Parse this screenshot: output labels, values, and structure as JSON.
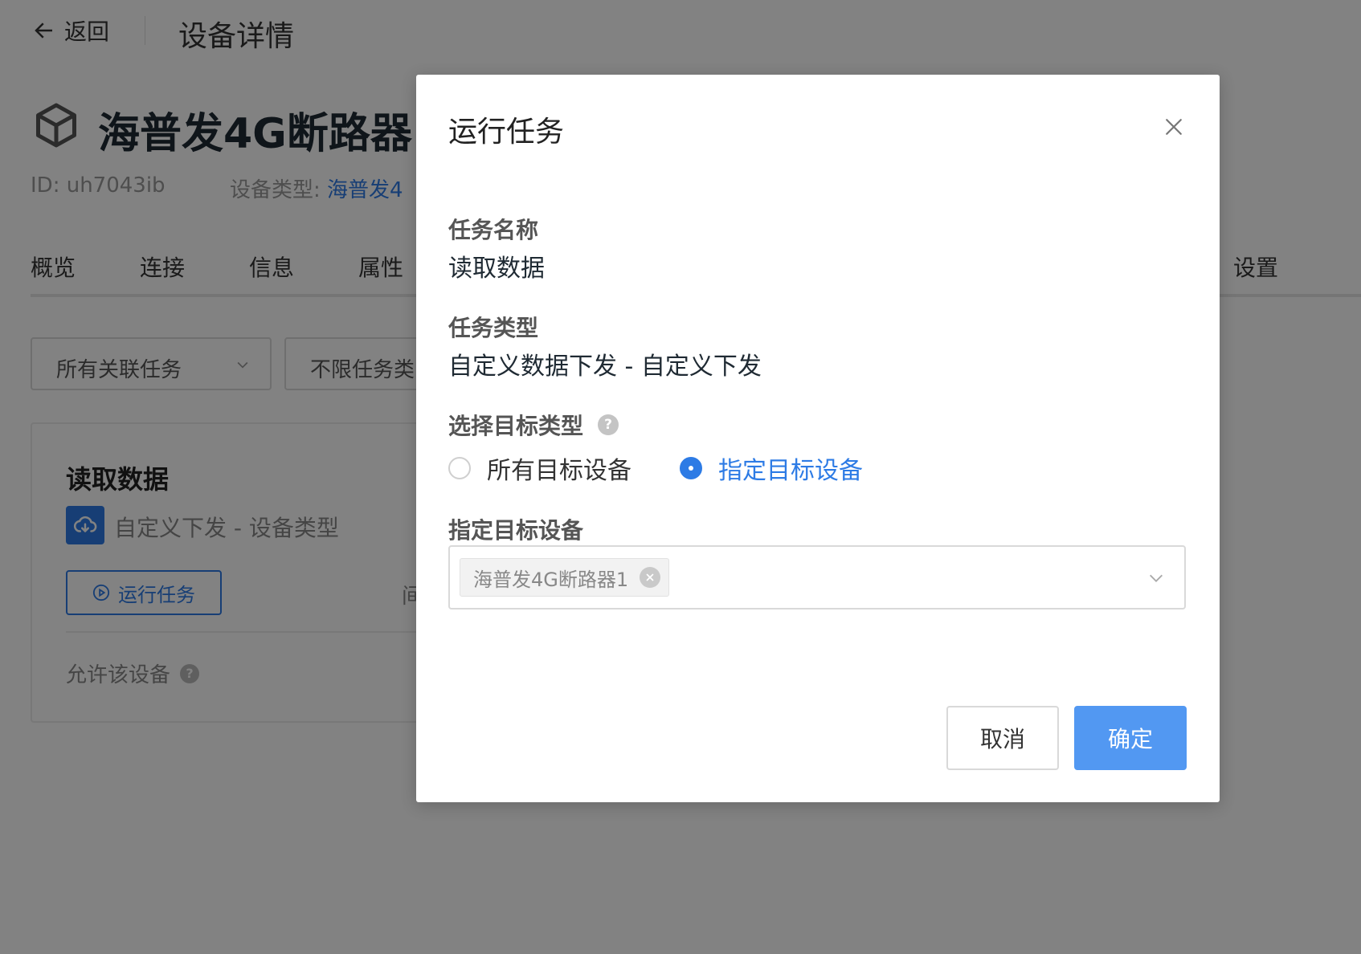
{
  "header": {
    "back_label": "返回",
    "page_title": "设备详情"
  },
  "device": {
    "name": "海普发4G断路器1",
    "id_text": "ID: uh7043ib",
    "type_label": "设备类型: ",
    "type_value": "海普发4"
  },
  "tabs": [
    {
      "label": "概览"
    },
    {
      "label": "连接"
    },
    {
      "label": "信息"
    },
    {
      "label": "属性"
    },
    {
      "label": "设置"
    }
  ],
  "filters": {
    "all_tasks": "所有关联任务",
    "task_type": "不限任务类"
  },
  "task_card": {
    "title": "读取数据",
    "type_text": "自定义下发 - 设备类型",
    "run_label": "运行任务",
    "partial_text": "间",
    "allow_text": "允许该设备",
    "help_mark": "?"
  },
  "modal": {
    "title": "运行任务",
    "task_name_label": "任务名称",
    "task_name_value": "读取数据",
    "task_type_label": "任务类型",
    "task_type_value": "自定义数据下发 - 自定义下发",
    "target_type_label": "选择目标类型",
    "help_mark": "?",
    "radio_all": "所有目标设备",
    "radio_specified": "指定目标设备",
    "selected_radio": "指定目标设备",
    "target_devices_label": "指定目标设备",
    "selected_tags": [
      "海普发4G断路器1"
    ],
    "cancel_label": "取消",
    "ok_label": "确定"
  },
  "colors": {
    "primary": "#2d7be5",
    "ok_button": "#5298f2",
    "overlay": "rgba(0,0,0,0.49)"
  },
  "icons": {
    "back": "arrow-left-icon",
    "device": "cube-icon",
    "task_type": "cloud-download-icon",
    "run": "play-circle-icon",
    "close": "close-icon",
    "dropdown": "chevron-down-icon",
    "tag_remove": "circle-x-icon",
    "help": "question-circle-icon"
  }
}
